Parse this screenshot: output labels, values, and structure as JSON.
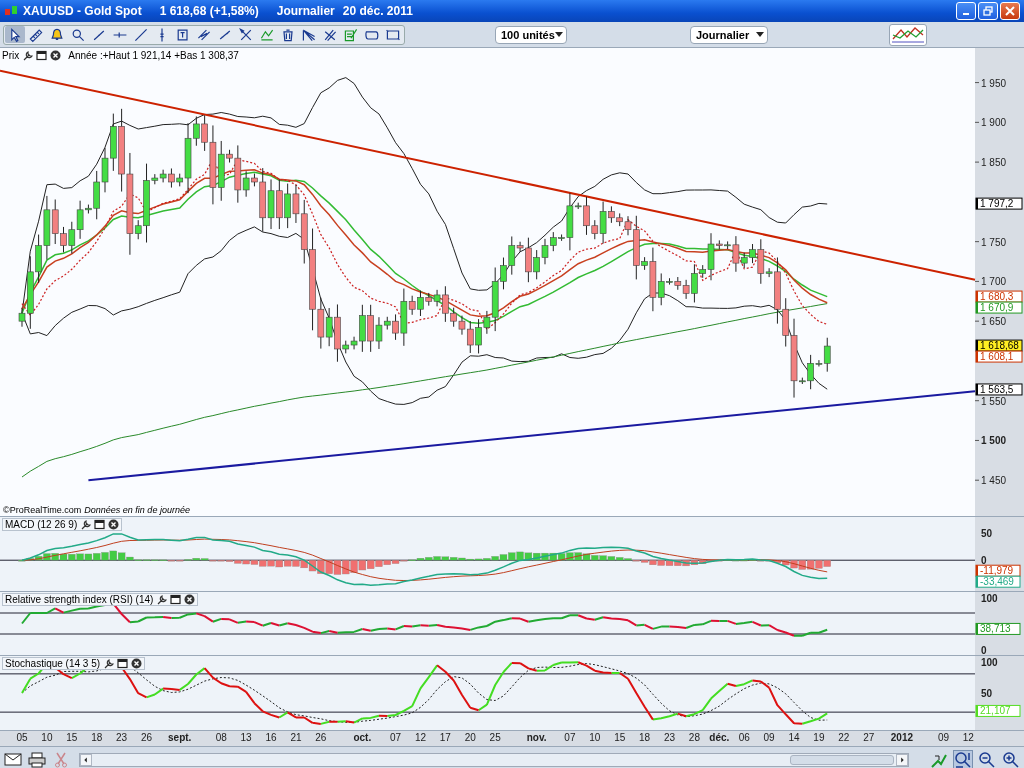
{
  "window": {
    "title": "XAUUSD - Gold Spot",
    "price": "1 618,68 (+1,58%)",
    "period": "Journalier",
    "date": "20 déc. 2011"
  },
  "toolbar": {
    "tools": [
      {
        "kind": "pointer",
        "selected": true
      },
      {
        "kind": "ruler",
        "selected": false
      },
      {
        "kind": "alarm",
        "selected": false
      },
      {
        "kind": "search",
        "selected": false
      },
      {
        "kind": "segment",
        "selected": false
      },
      {
        "kind": "horizontal",
        "selected": false
      },
      {
        "kind": "line",
        "selected": false
      },
      {
        "kind": "vertical",
        "selected": false
      },
      {
        "kind": "text",
        "selected": false
      },
      {
        "kind": "parallel",
        "selected": false
      },
      {
        "kind": "points",
        "selected": false
      },
      {
        "kind": "tools",
        "selected": false
      },
      {
        "kind": "levels",
        "selected": false
      },
      {
        "kind": "trash",
        "selected": false
      },
      {
        "kind": "fan",
        "selected": false
      },
      {
        "kind": "cross",
        "selected": false
      },
      {
        "kind": "indicator",
        "selected": false
      },
      {
        "kind": "loop",
        "selected": false
      },
      {
        "kind": "rectangle",
        "selected": false
      }
    ],
    "units": "100 unités",
    "timeframe": "Journalier"
  },
  "price_panel": {
    "title": "Prix",
    "info": "Année :+Haut 1 921,14 +Bas 1 308,37",
    "source": "©ProRealTime.com",
    "notice": "Données en fin de journée",
    "y_axis": [
      {
        "label": "1 950",
        "bold": false
      },
      {
        "label": "1 900",
        "bold": false
      },
      {
        "label": "1 850",
        "bold": false
      },
      {
        "label": "1 750",
        "bold": false
      },
      {
        "label": "1 700",
        "bold": false
      },
      {
        "label": "1 650",
        "bold": false
      },
      {
        "label": "1 550",
        "bold": false
      },
      {
        "label": "1 500",
        "bold": true
      },
      {
        "label": "1 450",
        "bold": false
      }
    ],
    "tags": [
      {
        "label": "1 797,2",
        "color": "#000000",
        "highlighted": false
      },
      {
        "label": "1 680,3",
        "color": "#cc3300",
        "highlighted": false
      },
      {
        "label": "1 670,9",
        "color": "#229922",
        "highlighted": false
      },
      {
        "label": "1 618,68",
        "color": "#000000",
        "highlighted": true
      },
      {
        "label": "1 608,1",
        "color": "#cc3300",
        "highlighted": false
      },
      {
        "label": "1 563,5",
        "color": "#000000",
        "highlighted": false
      }
    ]
  },
  "indicators": [
    {
      "kind": "macd",
      "title": "MACD (12 26 9)",
      "y_axis": [
        "50",
        "0"
      ],
      "tags": [
        {
          "label": "-11,979",
          "color": "#cc3300"
        },
        {
          "label": "-33,469",
          "color": "#22aa88"
        }
      ]
    },
    {
      "kind": "rsi",
      "title": "Relative strength index (RSI) (14)",
      "y_axis": [
        "100",
        "0"
      ],
      "tags": [
        {
          "label": "38,713",
          "color": "#229922"
        }
      ]
    },
    {
      "kind": "stochastic",
      "title": "Stochastique (14 3 5)",
      "y_axis": [
        "100",
        "50"
      ],
      "tags": [
        {
          "label": "21,107",
          "color": "#55dd22"
        }
      ]
    }
  ],
  "x_axis": [
    {
      "label": "05",
      "kind": "day"
    },
    {
      "label": "10",
      "kind": "day"
    },
    {
      "label": "15",
      "kind": "day"
    },
    {
      "label": "18",
      "kind": "day"
    },
    {
      "label": "23",
      "kind": "day"
    },
    {
      "label": "26",
      "kind": "day"
    },
    {
      "label": "sept.",
      "kind": "month"
    },
    {
      "label": "08",
      "kind": "day"
    },
    {
      "label": "13",
      "kind": "day"
    },
    {
      "label": "16",
      "kind": "day"
    },
    {
      "label": "21",
      "kind": "day"
    },
    {
      "label": "26",
      "kind": "day"
    },
    {
      "label": "oct.",
      "kind": "month"
    },
    {
      "label": "07",
      "kind": "day"
    },
    {
      "label": "12",
      "kind": "day"
    },
    {
      "label": "17",
      "kind": "day"
    },
    {
      "label": "20",
      "kind": "day"
    },
    {
      "label": "25",
      "kind": "day"
    },
    {
      "label": "nov.",
      "kind": "month"
    },
    {
      "label": "07",
      "kind": "day"
    },
    {
      "label": "10",
      "kind": "day"
    },
    {
      "label": "15",
      "kind": "day"
    },
    {
      "label": "18",
      "kind": "day"
    },
    {
      "label": "23",
      "kind": "day"
    },
    {
      "label": "28",
      "kind": "day"
    },
    {
      "label": "déc.",
      "kind": "month"
    },
    {
      "label": "06",
      "kind": "day"
    },
    {
      "label": "09",
      "kind": "day"
    },
    {
      "label": "14",
      "kind": "day"
    },
    {
      "label": "19",
      "kind": "day"
    },
    {
      "label": "22",
      "kind": "day"
    },
    {
      "label": "27",
      "kind": "day"
    },
    {
      "label": "2012",
      "kind": "month"
    },
    {
      "label": "09",
      "kind": "day"
    },
    {
      "label": "12",
      "kind": "day"
    }
  ]
}
